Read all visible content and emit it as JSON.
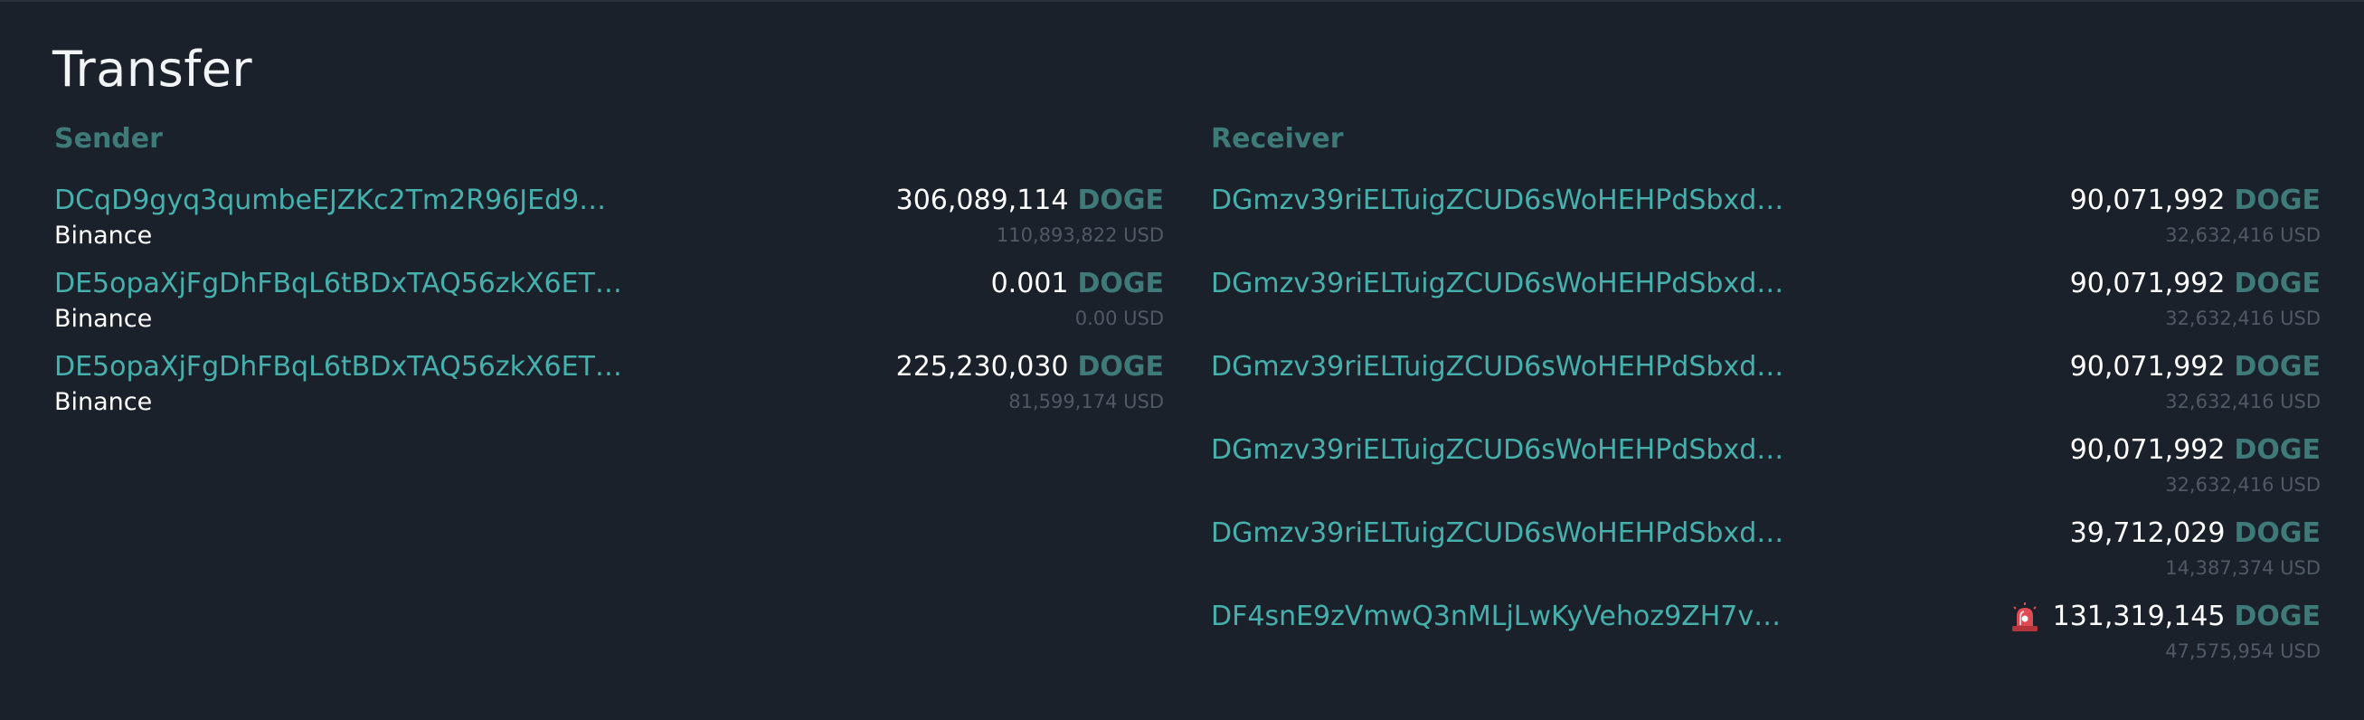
{
  "title": "Transfer",
  "sender": {
    "heading": "Sender",
    "rows": [
      {
        "address": "DCqD9gyq3qumbeEJZKc2Tm2R96JEd9…",
        "owner": "Binance",
        "amount": "306,089,114",
        "currency": "DOGE",
        "usd": "110,893,822 USD"
      },
      {
        "address": "DE5opaXjFgDhFBqL6tBDxTAQ56zkX6ET…",
        "owner": "Binance",
        "amount": "0.001",
        "currency": "DOGE",
        "usd": "0.00 USD"
      },
      {
        "address": "DE5opaXjFgDhFBqL6tBDxTAQ56zkX6ET…",
        "owner": "Binance",
        "amount": "225,230,030",
        "currency": "DOGE",
        "usd": "81,599,174 USD"
      }
    ]
  },
  "receiver": {
    "heading": "Receiver",
    "rows": [
      {
        "address": "DGmzv39riELTuigZCUD6sWoHEHPdSbxd…",
        "amount": "90,071,992",
        "currency": "DOGE",
        "usd": "32,632,416 USD"
      },
      {
        "address": "DGmzv39riELTuigZCUD6sWoHEHPdSbxd…",
        "amount": "90,071,992",
        "currency": "DOGE",
        "usd": "32,632,416 USD"
      },
      {
        "address": "DGmzv39riELTuigZCUD6sWoHEHPdSbxd…",
        "amount": "90,071,992",
        "currency": "DOGE",
        "usd": "32,632,416 USD"
      },
      {
        "address": "DGmzv39riELTuigZCUD6sWoHEHPdSbxd…",
        "amount": "90,071,992",
        "currency": "DOGE",
        "usd": "32,632,416 USD"
      },
      {
        "address": "DGmzv39riELTuigZCUD6sWoHEHPdSbxd…",
        "amount": "39,712,029",
        "currency": "DOGE",
        "usd": "14,387,374 USD"
      },
      {
        "address": "DF4snE9zVmwQ3nMLjLwKyVehoz9ZH7v…",
        "amount": "131,319,145",
        "currency": "DOGE",
        "usd": "47,575,954 USD",
        "icon": "siren-icon"
      }
    ]
  },
  "colors": {
    "background": "#1b212a",
    "link": "#45b0ac",
    "accent": "#3e7a78",
    "muted": "#4f5a66",
    "text": "#ffffff"
  }
}
